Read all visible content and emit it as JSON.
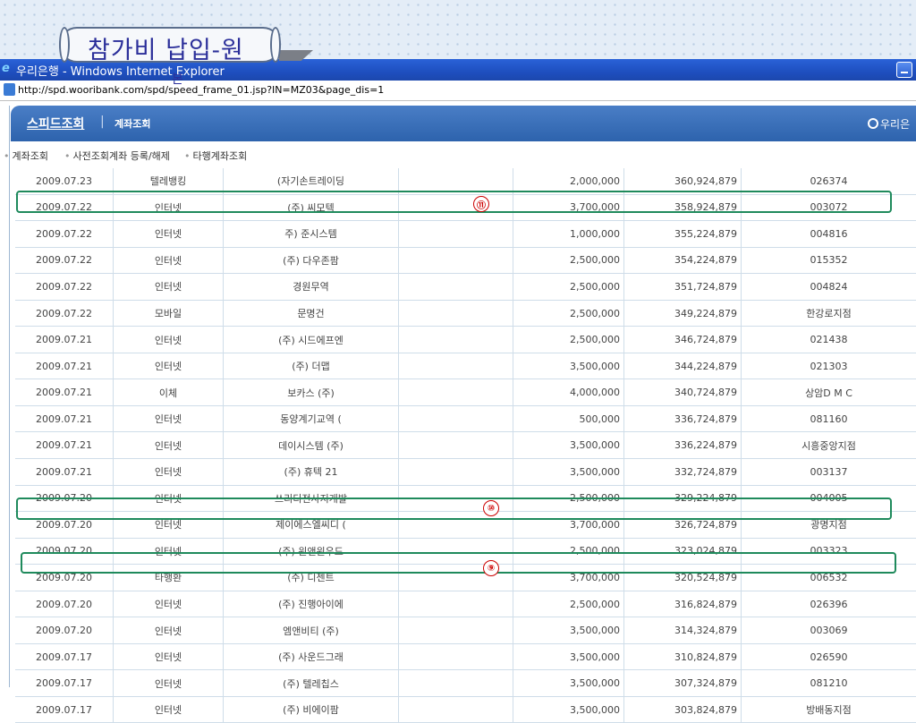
{
  "slide": {
    "title": "참가비 납입-원",
    "title_overflow": "본"
  },
  "window": {
    "icon": "e",
    "title": "우리은행 - Windows Internet Explorer",
    "url": "http://spd.wooribank.com/spd/speed_frame_01.jsp?IN=MZ03&page_dis=1"
  },
  "app": {
    "brand": "스피드조회",
    "separator": "|",
    "section": "계좌조회",
    "bank": "우리은"
  },
  "submenu": [
    {
      "label": "계좌조회"
    },
    {
      "label": "사전조회계좌 등록/해제"
    },
    {
      "label": "타행계좌조회"
    }
  ],
  "rows": [
    {
      "date": "2009.07.23",
      "type": "텔레뱅킹",
      "memo": "(자기손트레이딩",
      "amount": "2,000,000",
      "balance": "360,924,879",
      "branch": "026374"
    },
    {
      "date": "2009.07.22",
      "type": "인터넷",
      "memo": "(주) 씨모텍",
      "amount": "3,700,000",
      "balance": "358,924,879",
      "branch": "003072"
    },
    {
      "date": "2009.07.22",
      "type": "인터넷",
      "memo": "주) 준시스템",
      "amount": "1,000,000",
      "balance": "355,224,879",
      "branch": "004816"
    },
    {
      "date": "2009.07.22",
      "type": "인터넷",
      "memo": "(주) 다우존팜",
      "amount": "2,500,000",
      "balance": "354,224,879",
      "branch": "015352"
    },
    {
      "date": "2009.07.22",
      "type": "인터넷",
      "memo": "경원무역",
      "amount": "2,500,000",
      "balance": "351,724,879",
      "branch": "004824"
    },
    {
      "date": "2009.07.22",
      "type": "모바일",
      "memo": "문명건",
      "amount": "2,500,000",
      "balance": "349,224,879",
      "branch": "한강로지점"
    },
    {
      "date": "2009.07.21",
      "type": "인터넷",
      "memo": "(주) 시드에프엔",
      "amount": "2,500,000",
      "balance": "346,724,879",
      "branch": "021438"
    },
    {
      "date": "2009.07.21",
      "type": "인터넷",
      "memo": "(주) 더맵",
      "amount": "3,500,000",
      "balance": "344,224,879",
      "branch": "021303"
    },
    {
      "date": "2009.07.21",
      "type": "이체",
      "memo": "보카스 (주)",
      "amount": "4,000,000",
      "balance": "340,724,879",
      "branch": "상암D M C"
    },
    {
      "date": "2009.07.21",
      "type": "인터넷",
      "memo": "동양계기교역 (",
      "amount": "500,000",
      "balance": "336,724,879",
      "branch": "081160"
    },
    {
      "date": "2009.07.21",
      "type": "인터넷",
      "memo": "데이시스템 (주)",
      "amount": "3,500,000",
      "balance": "336,224,879",
      "branch": "시흥중앙지점"
    },
    {
      "date": "2009.07.21",
      "type": "인터넷",
      "memo": "(주) 휴텍 21",
      "amount": "3,500,000",
      "balance": "332,724,879",
      "branch": "003137"
    },
    {
      "date": "2009.07.20",
      "type": "인터넷",
      "memo": "쓰리디전사지개발",
      "amount": "2,500,000",
      "balance": "329,224,879",
      "branch": "004005"
    },
    {
      "date": "2009.07.20",
      "type": "인터넷",
      "memo": "제이에스엘씨디 (",
      "amount": "3,700,000",
      "balance": "326,724,879",
      "branch": "광명지점"
    },
    {
      "date": "2009.07.20",
      "type": "인터넷",
      "memo": "(주) 윈앤윈우드",
      "amount": "2,500,000",
      "balance": "323,024,879",
      "branch": "003323"
    },
    {
      "date": "2009.07.20",
      "type": "타행환",
      "memo": "(주) 디젠트",
      "amount": "3,700,000",
      "balance": "320,524,879",
      "branch": "006532"
    },
    {
      "date": "2009.07.20",
      "type": "인터넷",
      "memo": "(주) 진행아이에",
      "amount": "2,500,000",
      "balance": "316,824,879",
      "branch": "026396"
    },
    {
      "date": "2009.07.20",
      "type": "인터넷",
      "memo": "엠앤비티 (주)",
      "amount": "3,500,000",
      "balance": "314,324,879",
      "branch": "003069"
    },
    {
      "date": "2009.07.17",
      "type": "인터넷",
      "memo": "(주) 사운드그래",
      "amount": "3,500,000",
      "balance": "310,824,879",
      "branch": "026590"
    },
    {
      "date": "2009.07.17",
      "type": "인터넷",
      "memo": "(주) 텔레칩스",
      "amount": "3,500,000",
      "balance": "307,324,879",
      "branch": "081210"
    },
    {
      "date": "2009.07.17",
      "type": "인터넷",
      "memo": "(주) 비에이팜",
      "amount": "3,500,000",
      "balance": "303,824,879",
      "branch": "방배동지점"
    }
  ],
  "annotations": [
    {
      "label": "⑪"
    },
    {
      "label": "⑩"
    },
    {
      "label": "⑨"
    }
  ],
  "colors": {
    "highlight": "#1f8a5c",
    "marker": "#cc0000",
    "header": "#2d63ad"
  }
}
